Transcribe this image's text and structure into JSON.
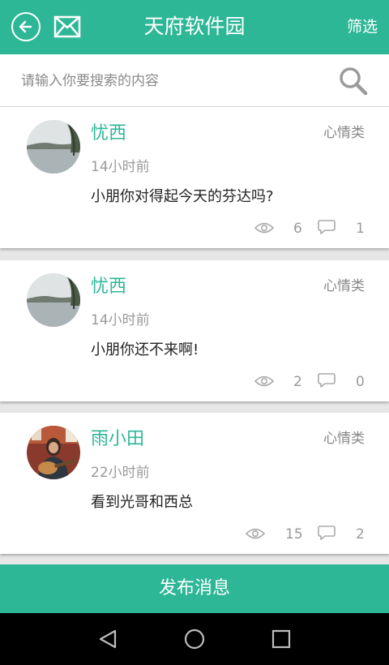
{
  "header": {
    "title": "天府软件园",
    "filter_label": "筛选"
  },
  "search": {
    "placeholder": "请输入你要搜索的内容"
  },
  "posts": [
    {
      "user": "忧西",
      "category": "心情类",
      "time": "14小时前",
      "content": "小朋你对得起今天的芬达吗?",
      "views": "6",
      "comments": "1"
    },
    {
      "user": "忧西",
      "category": "心情类",
      "time": "14小时前",
      "content": "小朋你还不来啊!",
      "views": "2",
      "comments": "0"
    },
    {
      "user": "雨小田",
      "category": "心情类",
      "time": "22小时前",
      "content": "看到光哥和西总",
      "views": "15",
      "comments": "2"
    }
  ],
  "publish_label": "发布消息",
  "colors": {
    "accent": "#2db797",
    "background": "#e6e6e6"
  },
  "icons": [
    "back-icon",
    "mail-icon",
    "search-icon",
    "eye-icon",
    "comment-icon",
    "nav-back-icon",
    "nav-home-icon",
    "nav-recents-icon"
  ]
}
